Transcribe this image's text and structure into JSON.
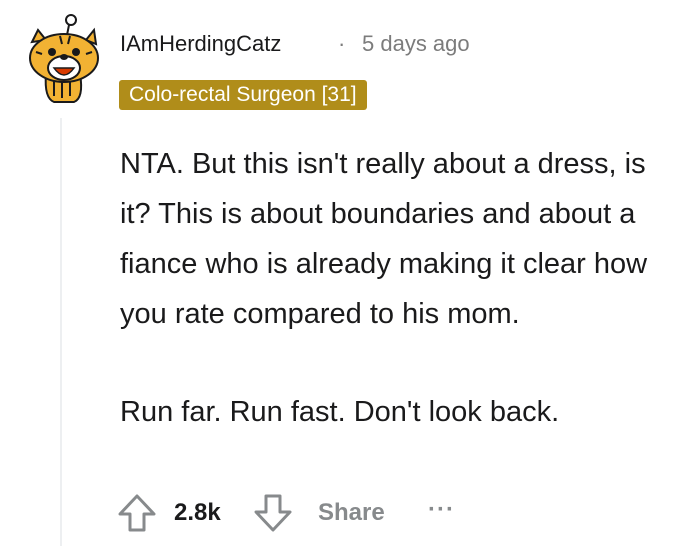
{
  "comment": {
    "author": "IAmHerdingCatz",
    "separator": "·",
    "timestamp": "5 days ago",
    "flair": "Colo-rectal Surgeon [31]",
    "paragraphs": [
      "NTA. But this isn't really about a dress, is it? This is about boundaries and about a fiance who is already making it clear how you rate compared to his mom.",
      "Run far. Run fast. Don't look back."
    ],
    "score": "2.8k",
    "share_label": "Share",
    "more_label": "···"
  },
  "icons": {
    "avatar": "snoo-cat-avatar",
    "upvote": "arrow-up-icon",
    "downvote": "arrow-down-icon",
    "more": "more-dots-icon"
  },
  "colors": {
    "flair_bg": "#b08d1a",
    "flair_text": "#ffffff",
    "meta_gray": "#7c7c7c",
    "action_gray": "#878a8c",
    "thread_line": "#edeff1"
  }
}
